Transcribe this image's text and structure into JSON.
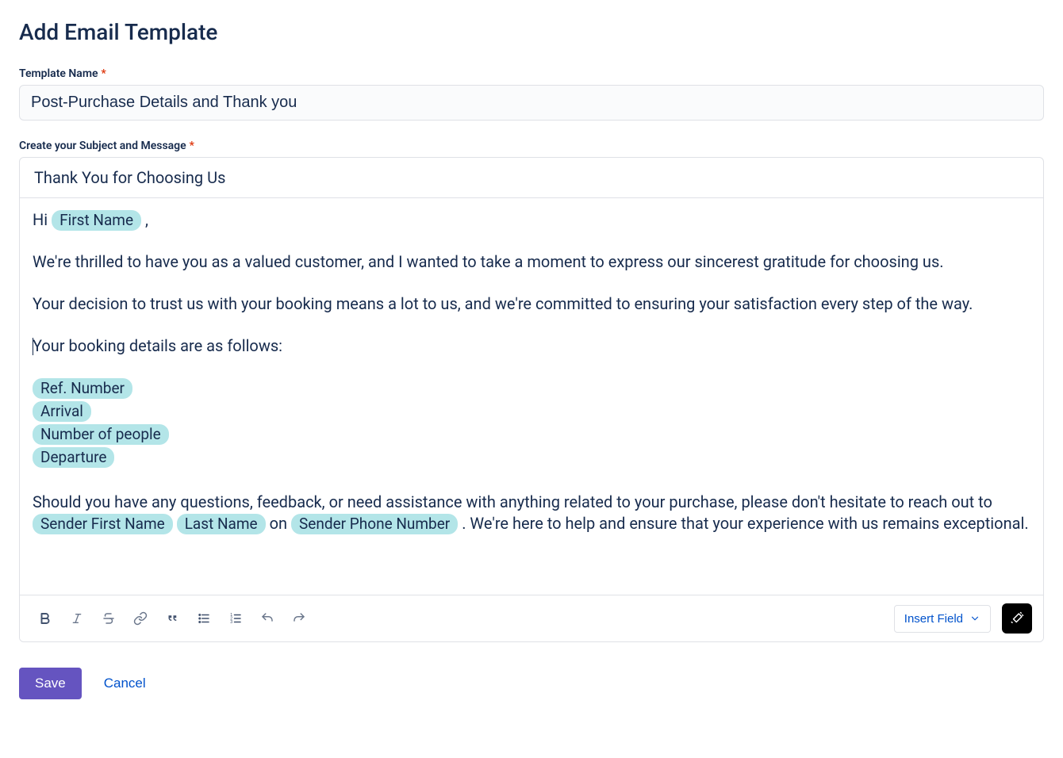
{
  "page": {
    "title": "Add Email Template"
  },
  "fields": {
    "template_name_label": "Template Name",
    "template_name_value": "Post-Purchase Details and Thank you",
    "subject_message_label": "Create your Subject and Message"
  },
  "email": {
    "subject": "Thank You for Choosing Us",
    "greeting_prefix": "Hi ",
    "greeting_token": "First Name",
    "greeting_suffix": " ,",
    "para1": "We're thrilled to have you as a valued customer, and I wanted to take a moment to express our sincerest gratitude for choosing us.",
    "para2": "Your decision to trust us with your booking means a lot to us, and we're committed to ensuring your satisfaction every step of the way.",
    "para3": "Your booking details are as follows:",
    "tokens": {
      "ref": "Ref. Number",
      "arrival": "Arrival",
      "people": "Number of people",
      "departure": "Departure"
    },
    "closing_a": "Should you have any questions, feedback, or need assistance with anything related to your purchase, please don't hesitate to reach out to ",
    "closing_token1": "Sender First Name",
    "closing_token2": "Last Name",
    "closing_b": " on ",
    "closing_token3": "Sender Phone Number",
    "closing_c": " . We're here to help and ensure that your experience with us remains exceptional."
  },
  "toolbar": {
    "insert_field_label": "Insert Field"
  },
  "actions": {
    "save": "Save",
    "cancel": "Cancel"
  }
}
